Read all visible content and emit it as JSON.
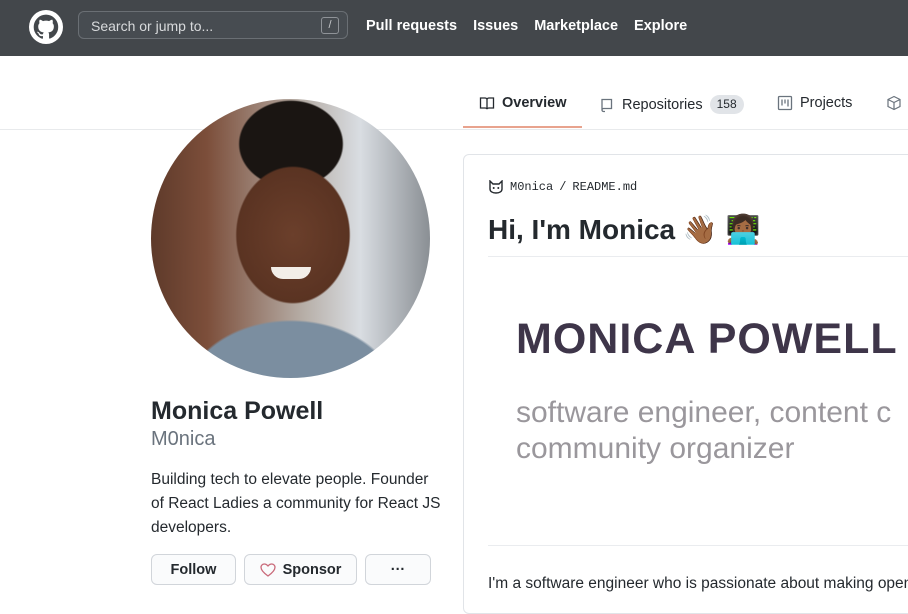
{
  "header": {
    "search_placeholder": "Search or jump to...",
    "search_shortcut": "/",
    "nav": [
      "Pull requests",
      "Issues",
      "Marketplace",
      "Explore"
    ]
  },
  "tabs": [
    {
      "label": "Overview",
      "icon": "book-icon",
      "active": true
    },
    {
      "label": "Repositories",
      "icon": "repo-icon",
      "count": "158"
    },
    {
      "label": "Projects",
      "icon": "project-icon"
    },
    {
      "label": "",
      "icon": "package-icon"
    }
  ],
  "profile": {
    "name": "Monica Powell",
    "login": "M0nica",
    "bio": "Building tech to elevate people. Founder of React Ladies a community for React JS developers.",
    "buttons": {
      "follow": "Follow",
      "sponsor": "Sponsor",
      "more": "···"
    }
  },
  "readme": {
    "owner": "M0nica",
    "separator": "/",
    "file": "README.md",
    "heading": "Hi, I'm Monica 👋🏾 👩🏾‍💻",
    "banner_title": "MONICA POWELL",
    "banner_tagline_1": "software engineer, content c",
    "banner_tagline_2": "community organizer",
    "paragraph": "I'm a software engineer who is passionate about making open-so"
  },
  "colors": {
    "header_bg": "#43474b",
    "active_tab_underline": "#e8a38e",
    "banner_title": "#3e3549",
    "banner_tagline": "#9a979c"
  }
}
